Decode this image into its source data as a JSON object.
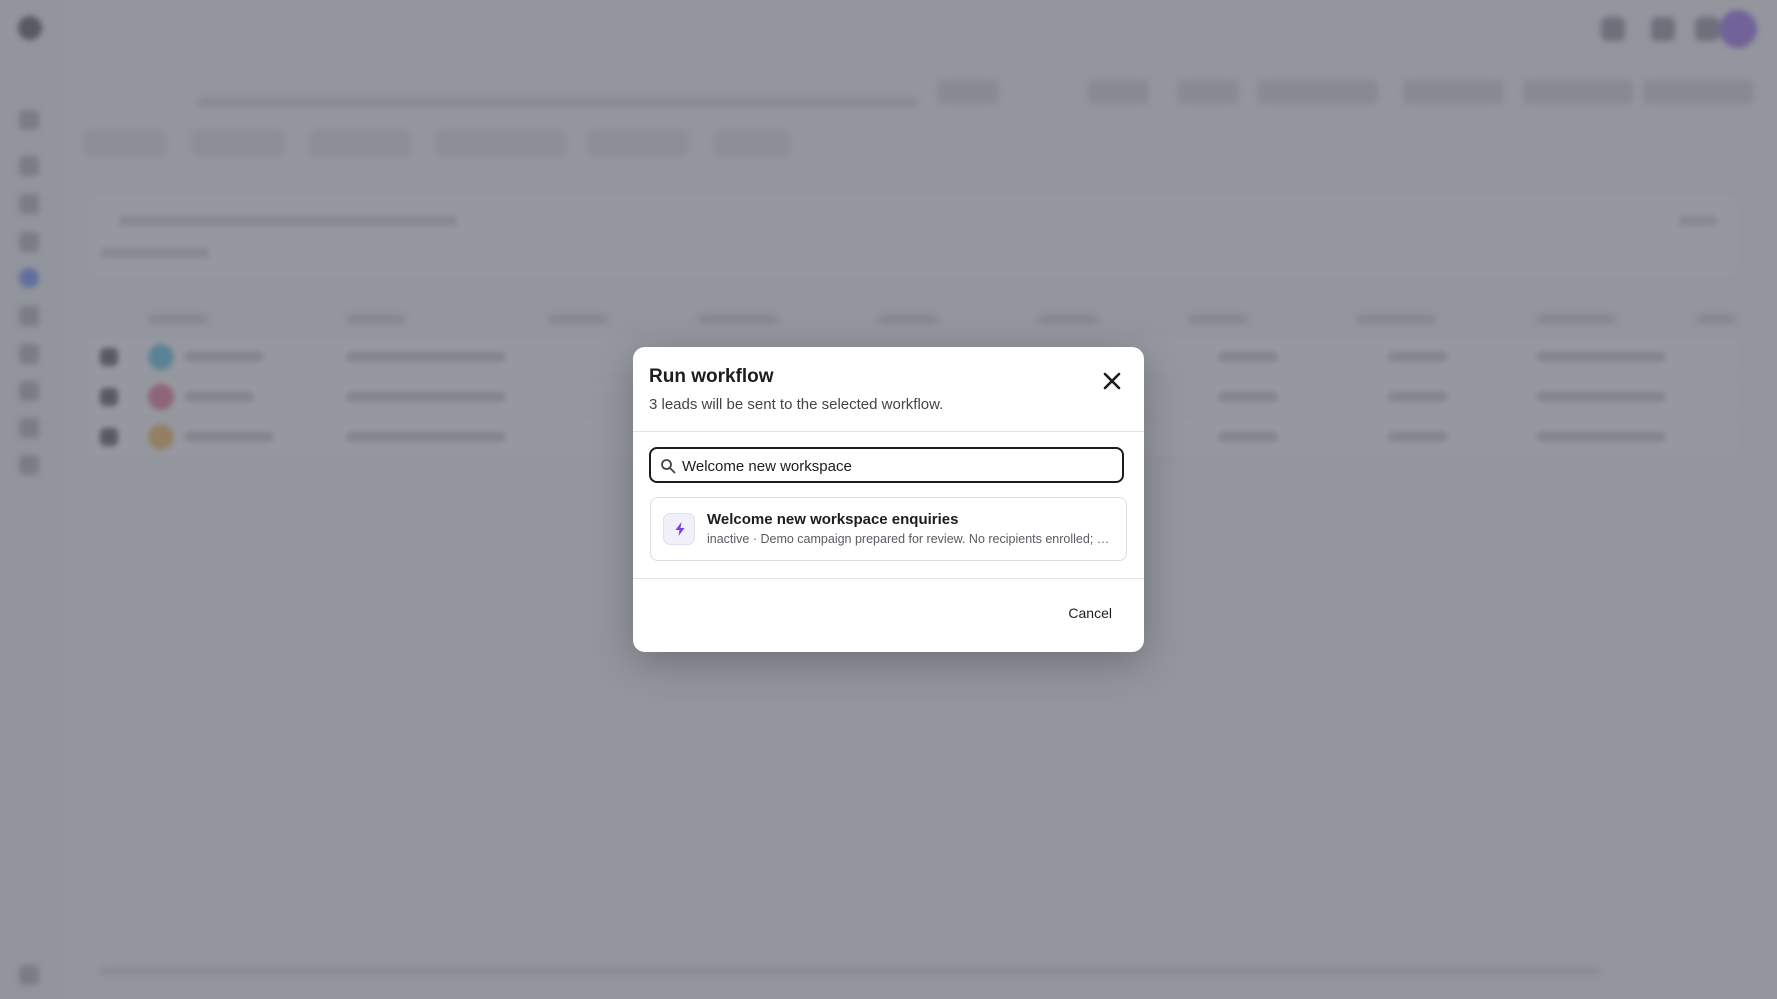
{
  "modal": {
    "title": "Run workflow",
    "description": "3 leads will be sent to the selected workflow.",
    "search": {
      "value": "Welcome new workspace"
    },
    "results": [
      {
        "title": "Welcome new workspace enquiries",
        "description": "inactive · Demo campaign prepared for review. No recipients enrolled; …",
        "icon": "bolt-icon"
      }
    ],
    "cancel_label": "Cancel",
    "accent_color": "#7b3fe4"
  },
  "background": {
    "row_avatar_colors": [
      "#2bb3d6",
      "#e0486a",
      "#f0a52a"
    ]
  }
}
